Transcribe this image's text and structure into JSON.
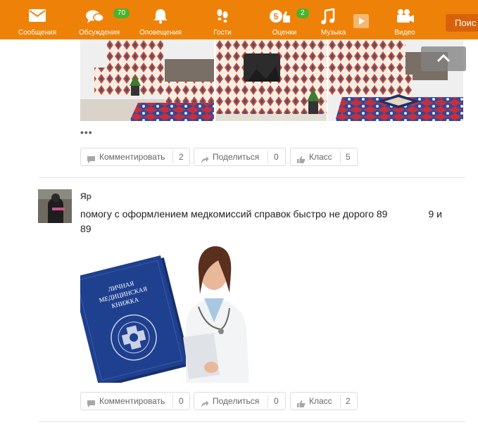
{
  "nav": {
    "items": [
      {
        "label": "Сообщения",
        "icon": "envelope-icon"
      },
      {
        "label": "Обсуждения",
        "icon": "speech-bubbles-icon",
        "badge": "70"
      },
      {
        "label": "Оповещения",
        "icon": "bell-icon"
      },
      {
        "label": "Гости",
        "icon": "footprints-icon"
      },
      {
        "label": "Оценки",
        "icon": "rating-five-icon",
        "badge": "2"
      },
      {
        "label": "Музыка",
        "icon": "music-note-icon"
      },
      {
        "label": "Видео",
        "icon": "video-camera-icon"
      }
    ],
    "search_label": "Поис"
  },
  "post1": {
    "more": "•••",
    "actions": {
      "comment": {
        "label": "Комментировать",
        "count": "2"
      },
      "share": {
        "label": "Поделиться",
        "count": "0"
      },
      "like": {
        "label": "Класс",
        "count": "5"
      }
    }
  },
  "post2": {
    "author": "Яр",
    "text_line1": "помогу с  оформлением медкомиссий справок быстро не дорого 89",
    "text_line1_end": "9 и",
    "text_line2": "89",
    "book_title_1": "ЛИЧНАЯ",
    "book_title_2": "МЕДИЦИНСКАЯ",
    "book_title_3": "КНИЖКА",
    "actions": {
      "comment": {
        "label": "Комментировать",
        "count": "0"
      },
      "share": {
        "label": "Поделиться",
        "count": "0"
      },
      "like": {
        "label": "Класс",
        "count": "2"
      }
    }
  },
  "colors": {
    "brand": "#ee8208",
    "badge": "#48b32d",
    "book": "#1f3f8f"
  }
}
